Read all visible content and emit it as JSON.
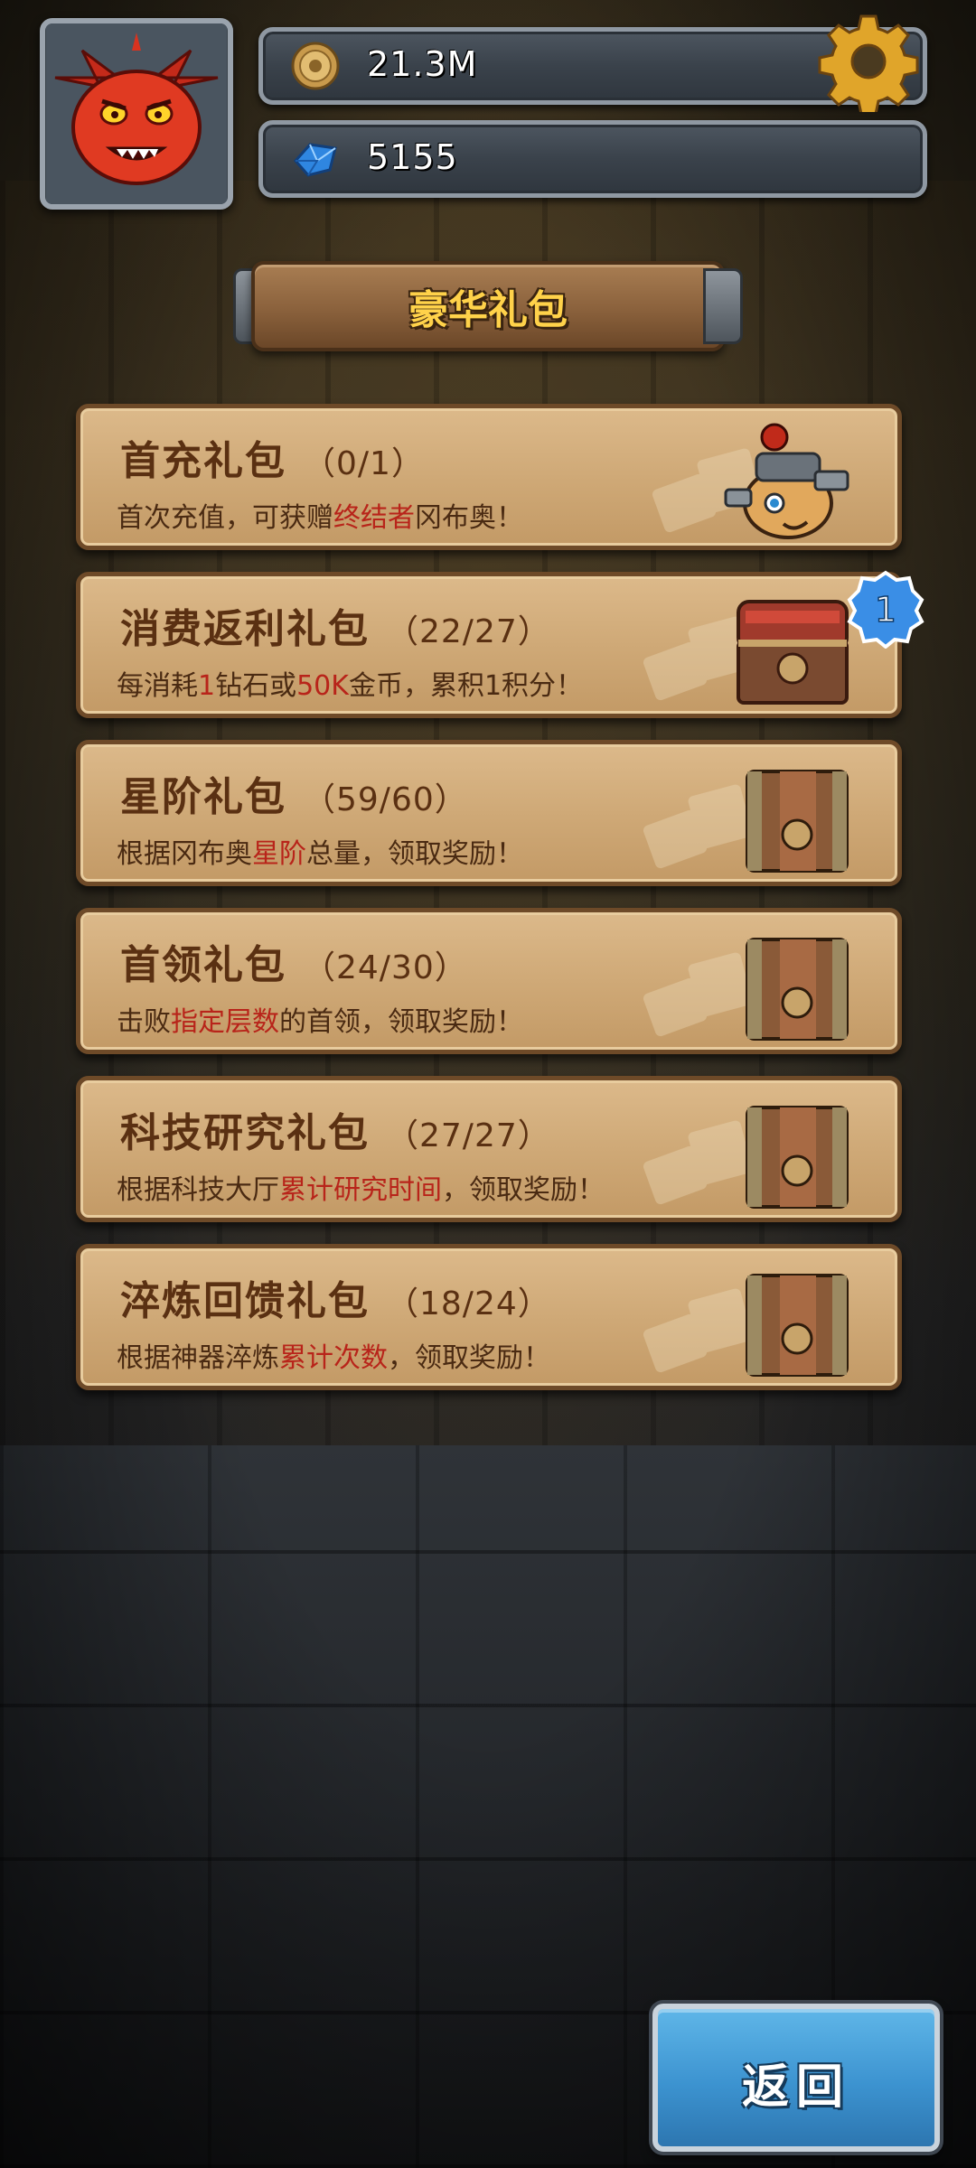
{
  "header": {
    "avatar_icon": "red-dragon-avatar-icon",
    "gold": {
      "icon": "gold-coin-icon",
      "value": "21.3M"
    },
    "gems": {
      "icon": "blue-gem-icon",
      "value": "5155"
    },
    "settings_icon": "gear-icon"
  },
  "title": "豪华礼包",
  "packs": [
    {
      "title": "首充礼包",
      "count": "（0/1）",
      "desc_parts": [
        "首次充值，可获赠",
        "终结者",
        "冈布奥！"
      ],
      "art": "robot-creature-icon"
    },
    {
      "title": "消费返利礼包",
      "count": "（22/27）",
      "desc_parts": [
        "每消耗",
        "1",
        "钻石或",
        "50K",
        "金币，累积1积分！"
      ],
      "art": "red-treasure-chest-icon",
      "badge": "1"
    },
    {
      "title": "星阶礼包",
      "count": "（59/60）",
      "desc_parts": [
        "根据冈布奥",
        "星阶",
        "总量，领取奖励！"
      ],
      "art": "treasure-chest-icon"
    },
    {
      "title": "首领礼包",
      "count": "（24/30）",
      "desc_parts": [
        "击败",
        "指定层数",
        "的首领，领取奖励！"
      ],
      "art": "treasure-chest-icon"
    },
    {
      "title": "科技研究礼包",
      "count": "（27/27）",
      "desc_parts": [
        "根据科技大厅",
        "累计研究时间",
        "，领取奖励！"
      ],
      "art": "treasure-chest-icon"
    },
    {
      "title": "淬炼回馈礼包",
      "count": "（18/24）",
      "desc_parts": [
        "根据神器淬炼",
        "累计次数",
        "，领取奖励！"
      ],
      "art": "treasure-chest-icon"
    }
  ],
  "back_button": "返回",
  "colors": {
    "card_bg": "#d4b07e",
    "card_border": "#6e4a28",
    "title_text": "#ffd24a",
    "highlight": "#b8241a",
    "back_button": "#3c93d0"
  }
}
